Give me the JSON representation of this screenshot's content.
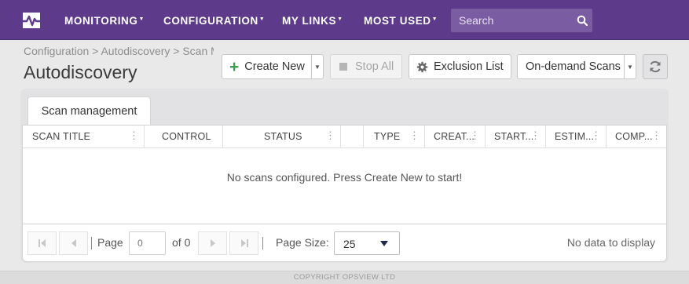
{
  "colors": {
    "nav_bg": "#5d3a8a",
    "accent_green": "#3aa04b"
  },
  "nav": {
    "items": [
      {
        "label": "MONITORING"
      },
      {
        "label": "CONFIGURATION"
      },
      {
        "label": "MY LINKS"
      },
      {
        "label": "MOST USED"
      }
    ],
    "search": {
      "placeholder": "Search",
      "value": "",
      "icon": "search-icon"
    },
    "logo_icon": "pulse-logo-icon"
  },
  "header": {
    "breadcrumb": "Configuration > Autodiscovery > Scan Management",
    "title": "Autodiscovery"
  },
  "toolbar": {
    "create_new": "Create New",
    "stop_all": "Stop All",
    "exclusion_list": "Exclusion List",
    "on_demand_scans": "On-demand Scans",
    "refresh_icon": "refresh-icon"
  },
  "tabs": [
    {
      "label": "Scan management",
      "active": true
    }
  ],
  "grid": {
    "columns": [
      "SCAN TITLE",
      "CONTROL",
      "STATUS",
      "",
      "TYPE",
      "CREAT...",
      "START...",
      "ESTIM...",
      "COMP..."
    ],
    "empty_message": "No scans configured. Press Create New to start!"
  },
  "pager": {
    "page_label": "Page",
    "page_value": "0",
    "of_label": "of 0",
    "page_size_label": "Page Size:",
    "page_size_value": "25",
    "status": "No data to display"
  },
  "footer": {
    "copyright": "COPYRIGHT OPSVIEW LTD"
  }
}
